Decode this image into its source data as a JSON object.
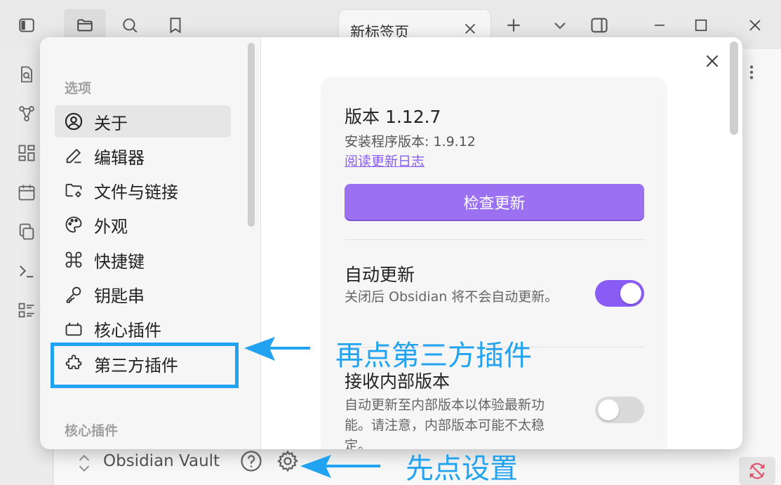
{
  "tab": {
    "title": "新标签页"
  },
  "vault": {
    "name": "Obsidian Vault"
  },
  "settings_nav": {
    "heading_options": "选项",
    "heading_core": "核心插件",
    "items": [
      {
        "label": "关于",
        "icon": "user-circle-icon",
        "active": true
      },
      {
        "label": "编辑器",
        "icon": "pencil-icon"
      },
      {
        "label": "文件与链接",
        "icon": "folder-cog-icon"
      },
      {
        "label": "外观",
        "icon": "palette-icon"
      },
      {
        "label": "快捷键",
        "icon": "command-icon"
      },
      {
        "label": "钥匙串",
        "icon": "key-icon"
      },
      {
        "label": "核心插件",
        "icon": "plug-block-icon"
      },
      {
        "label": "第三方插件",
        "icon": "puzzle-icon"
      }
    ]
  },
  "about": {
    "version_title": "版本 1.12.7",
    "installer_version": "安装程序版本: 1.9.12",
    "changelog_link": "阅读更新日志",
    "check_update_button": "检查更新",
    "auto_update": {
      "title": "自动更新",
      "desc": "关闭后 Obsidian 将不会自动更新。",
      "enabled": true
    },
    "insider": {
      "title": "接收内部版本",
      "desc": "自动更新至内部版本以体验最新功能。请注意，内部版本可能不太稳定。",
      "enabled": false
    }
  },
  "annotations": {
    "step2": "再点第三方插件",
    "step1": "先点设置"
  },
  "colors": {
    "accent": "#8a5cf6",
    "annotation": "#21a3f1"
  }
}
